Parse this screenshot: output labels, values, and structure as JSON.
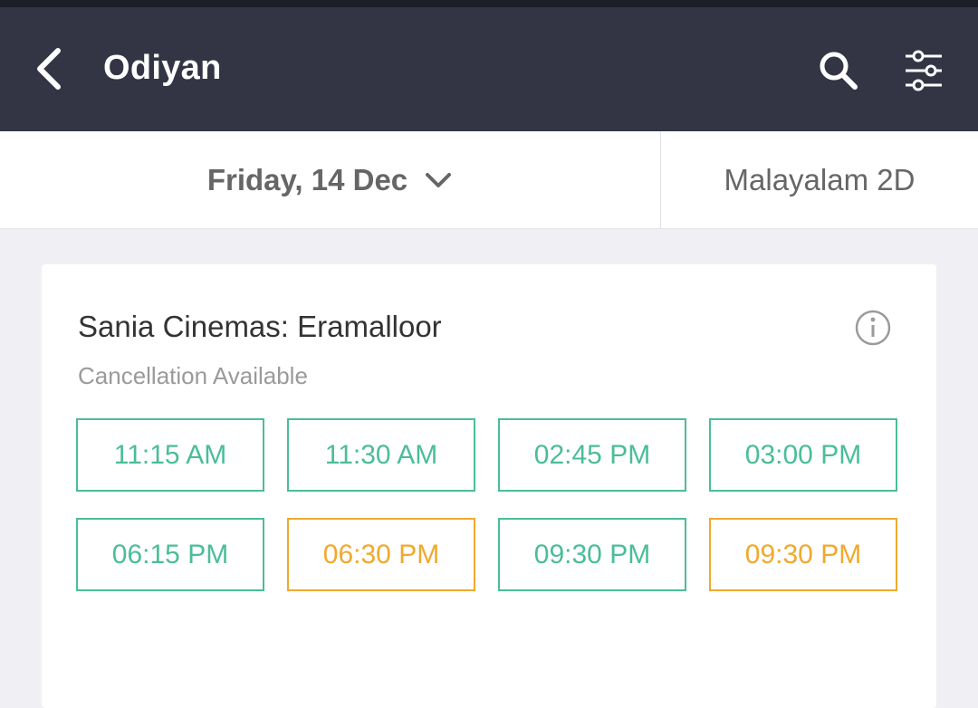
{
  "header": {
    "title": "Odiyan",
    "back_icon": "back-arrow-icon",
    "search_icon": "search-icon",
    "filter_icon": "filter-sliders-icon",
    "background_color": "#333545"
  },
  "date_bar": {
    "date": "Friday, 14 Dec",
    "chevron_icon": "chevron-down-icon",
    "format": "Malayalam 2D"
  },
  "cinema": {
    "name": "Sania Cinemas: Eramalloor",
    "info_icon": "info-icon",
    "cancellation": "Cancellation Available",
    "showtimes": [
      {
        "time": "11:15 AM",
        "status": "available"
      },
      {
        "time": "11:30 AM",
        "status": "available"
      },
      {
        "time": "02:45 PM",
        "status": "available"
      },
      {
        "time": "03:00 PM",
        "status": "available"
      },
      {
        "time": "06:15 PM",
        "status": "available"
      },
      {
        "time": "06:30 PM",
        "status": "filling-fast"
      },
      {
        "time": "09:30 PM",
        "status": "available"
      },
      {
        "time": "09:30 PM",
        "status": "filling-fast"
      }
    ]
  },
  "colors": {
    "available": "#4abd99",
    "filling_fast": "#f0a92e",
    "page_background": "#efeff4"
  }
}
